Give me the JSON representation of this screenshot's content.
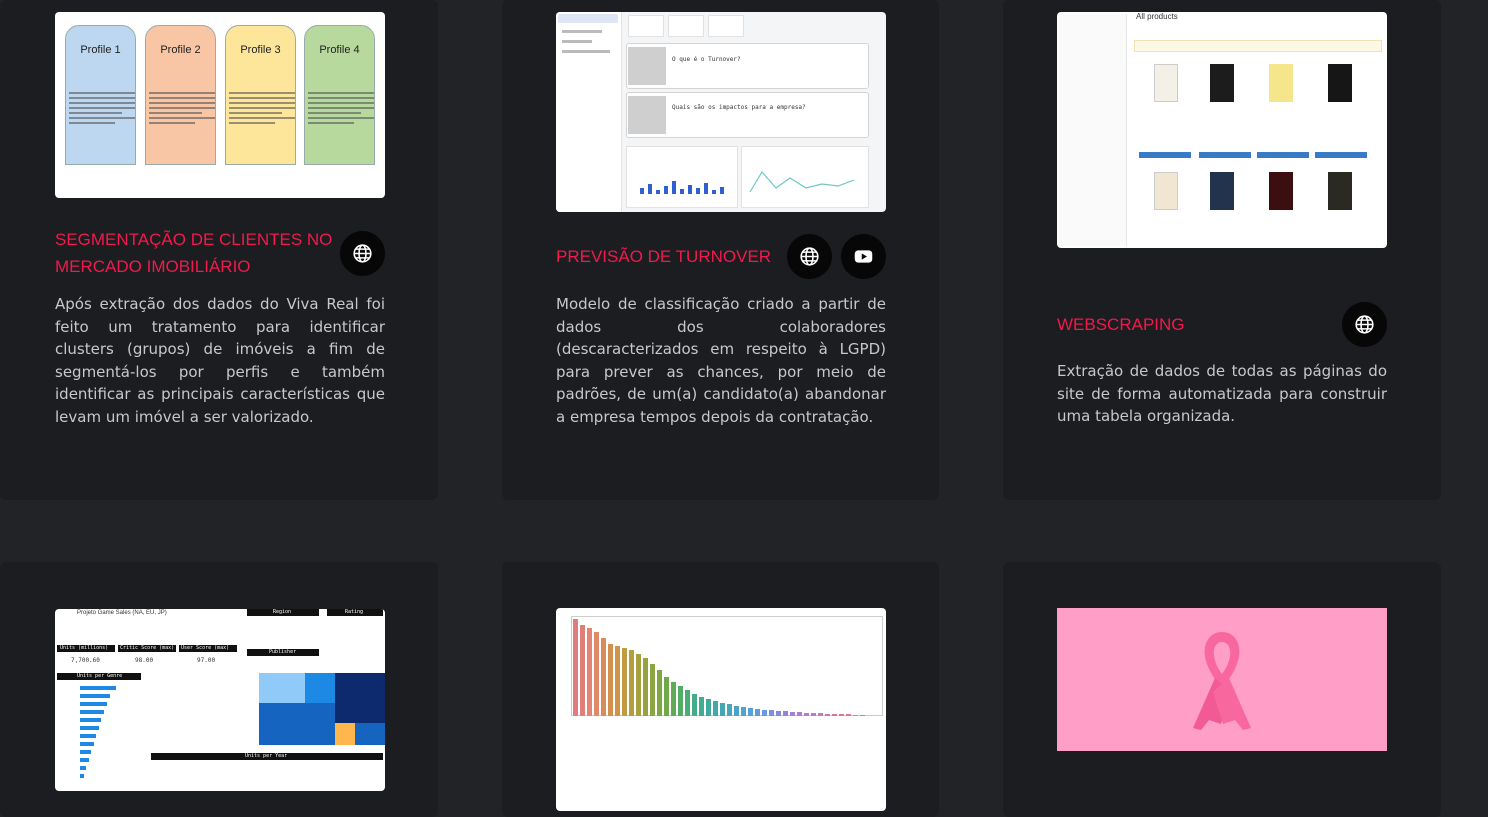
{
  "projects": [
    {
      "title_lines": [
        "SEGMENTAÇÃO DE CLIENTES NO",
        "MERCADO IMOBILIÁRIO"
      ],
      "description": "Após extração dos dados do Viva Real foi feito um tratamento para identificar clusters (grupos) de imóveis a fim de segmentá-los por perfis e também identificar as principais características que levam um imóvel a ser valorizado.",
      "thumb_profiles": [
        "Profile 1",
        "Profile 2",
        "Profile 3",
        "Profile 4"
      ],
      "thumb_profile_colors": [
        "#bcd7ef",
        "#f8c6a4",
        "#fde59a",
        "#b8d99d"
      ],
      "icons": [
        "globe-icon"
      ]
    },
    {
      "title_lines": [
        "PREVISÃO DE TURNOVER"
      ],
      "description": "Modelo de classificação criado a partir de dados dos colaboradores (descaracterizados em respeito à LGPD) para prever as chances, por meio de padrões, de um(a) candidato(a) abandonar a empresa tempos depois da contratação.",
      "thumb_q1": "O que é o Turnover?",
      "thumb_q2": "Quais são os impactos para a empresa?",
      "icons": [
        "globe-icon",
        "youtube-icon"
      ]
    },
    {
      "title_lines": [
        "WEBSCRAPING"
      ],
      "description": "Extração de dados de todas as páginas do site de forma automatizada para construir uma tabela organizada.",
      "thumb_heading": "All products",
      "icons": [
        "globe-icon"
      ]
    }
  ],
  "bottom": {
    "game_title": "Projeto Game Sales (NA, EU, JP)",
    "kpi_labels": [
      "Units (millions)",
      "Critic Score (max)",
      "User Score (max)"
    ],
    "kpi_values": [
      "7,700.60",
      "98.00",
      "97.00"
    ],
    "panel_region": "Region",
    "panel_rating": "Rating",
    "panel_publisher": "Publisher",
    "panel_genre": "Units per Genre",
    "panel_year": "Units per Year",
    "ribbon_bg": "#ff9ec7",
    "ribbon_color": "#f8689f"
  },
  "colors": {
    "accent": "#f2194c",
    "page_bg": "#212327",
    "card_bg": "#1b1d21",
    "text": "#c6c8cc",
    "icon_bg": "#070707"
  }
}
